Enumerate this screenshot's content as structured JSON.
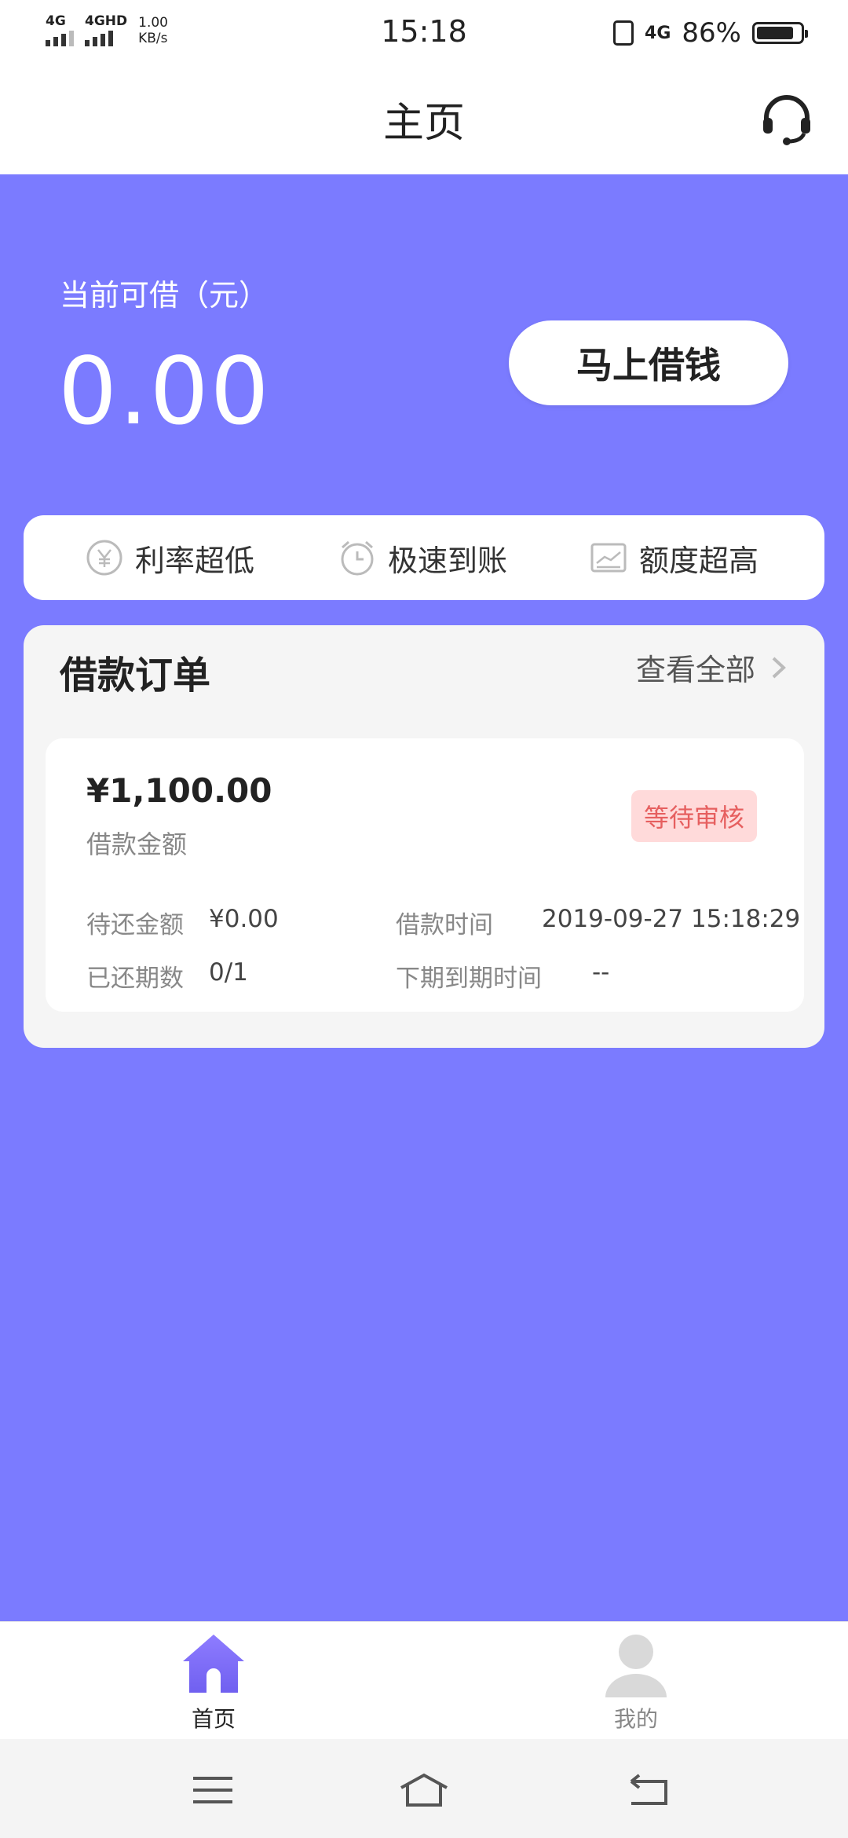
{
  "status_bar": {
    "sim1": "4G",
    "sim2": "4GHD",
    "speed_value": "1.00",
    "speed_unit": "KB/s",
    "time": "15:18",
    "network": "4G",
    "battery": "86%",
    "battery_level": 0.86
  },
  "header": {
    "title": "主页",
    "support_icon": "headset-icon"
  },
  "hero": {
    "label": "当前可借（元）",
    "amount": "0.00",
    "button": "马上借钱"
  },
  "features": [
    {
      "icon": "yuan-circle-icon",
      "label": "利率超低"
    },
    {
      "icon": "alarm-clock-icon",
      "label": "极速到账"
    },
    {
      "icon": "trend-chart-icon",
      "label": "额度超高"
    }
  ],
  "orders": {
    "title": "借款订单",
    "view_all": "查看全部",
    "item": {
      "amount": "¥1,100.00",
      "amount_label": "借款金额",
      "status": "等待审核",
      "due_label": "待还金额",
      "due_value": "¥0.00",
      "time_label": "借款时间",
      "time_value": "2019-09-27 15:18:29",
      "periods_label": "已还期数",
      "periods_value": "0/1",
      "next_due_label": "下期到期时间",
      "next_due_value": "--"
    }
  },
  "tabs": [
    {
      "label": "首页",
      "icon": "home-icon",
      "active": true
    },
    {
      "label": "我的",
      "icon": "user-icon",
      "active": false
    }
  ],
  "colors": {
    "brand": "#7B7BFF",
    "badge_bg": "#FFDADA",
    "badge_text": "#E65F5F"
  }
}
